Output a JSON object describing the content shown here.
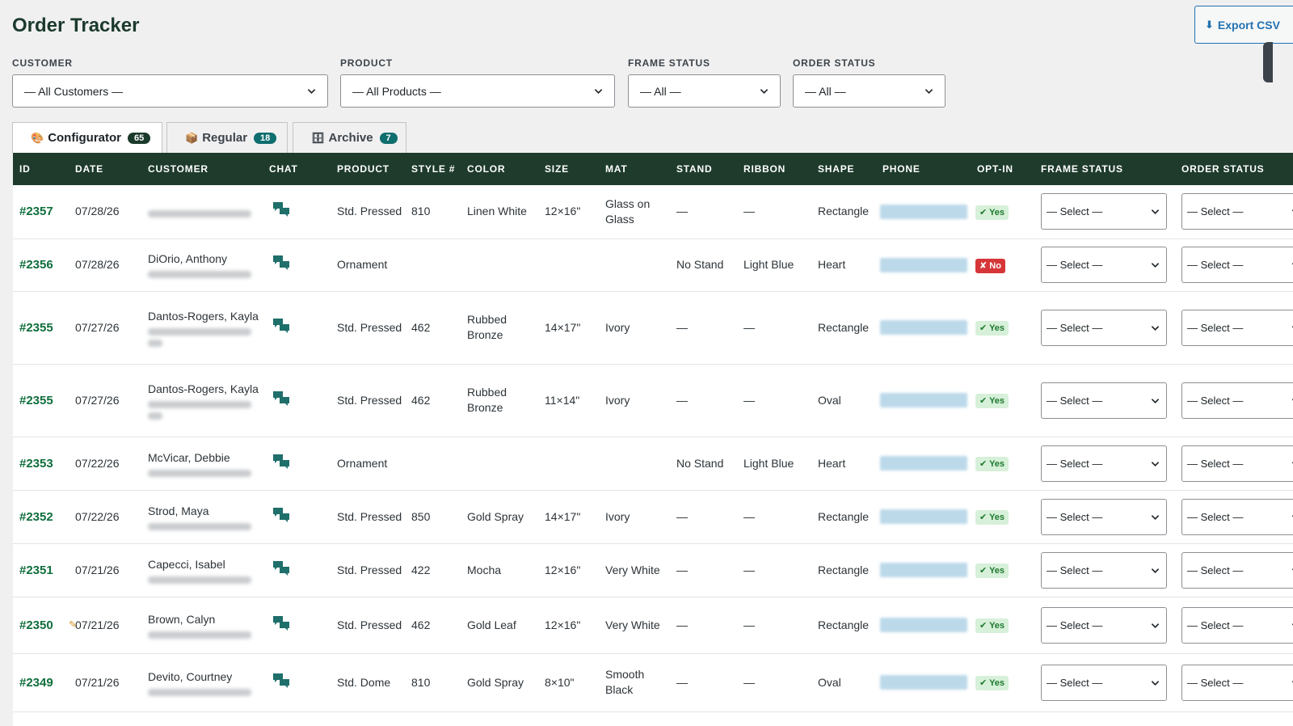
{
  "page": {
    "title": "Order Tracker"
  },
  "toolbar": {
    "export_label": "Export CSV"
  },
  "filters": [
    {
      "label": "CUSTOMER",
      "value": "— All Customers —"
    },
    {
      "label": "PRODUCT",
      "value": "— All Products —"
    },
    {
      "label": "FRAME STATUS",
      "value": "— All —"
    },
    {
      "label": "ORDER STATUS",
      "value": "— All —"
    }
  ],
  "tabs": [
    {
      "label": "Configurator",
      "count": "65",
      "icon": "palette-icon"
    },
    {
      "label": "Regular",
      "count": "18",
      "icon": "box-icon"
    },
    {
      "label": "Archive",
      "count": "7",
      "icon": "archive-icon"
    }
  ],
  "table": {
    "columns": [
      "ID",
      "DATE",
      "CUSTOMER",
      "CHAT",
      "PRODUCT",
      "STYLE #",
      "COLOR",
      "SIZE",
      "MAT",
      "STAND",
      "RIBBON",
      "SHAPE",
      "PHONE",
      "OPT-IN",
      "FRAME STATUS",
      "ORDER STATUS"
    ],
    "rows": [
      {
        "id": "#2357",
        "date": "07/28/26",
        "customer": "",
        "product": "Std. Pressed",
        "style": "810",
        "color": "Linen White",
        "size": "12×16\"",
        "mat": "Glass on Glass",
        "stand": "—",
        "ribbon": "—",
        "shape": "Rectangle",
        "optin": "✔ Yes",
        "optin_state": "yes",
        "frame_status": "— Select —",
        "order_status": "— Select —"
      },
      {
        "id": "#2356",
        "date": "07/28/26",
        "customer": "DiOrio, Anthony",
        "product": "Ornament",
        "style": "",
        "color": "",
        "size": "",
        "mat": "",
        "stand": "No Stand",
        "ribbon": "Light Blue",
        "shape": "Heart",
        "optin": "✘ No",
        "optin_state": "no",
        "frame_status": "— Select —",
        "order_status": "— Select —"
      },
      {
        "id": "#2355",
        "date": "07/27/26",
        "customer": "Dantos-Rogers, Kayla",
        "product": "Std. Pressed",
        "style": "462",
        "color": "Rubbed Bronze",
        "size": "14×17\"",
        "mat": "Ivory",
        "stand": "—",
        "ribbon": "—",
        "shape": "Rectangle",
        "optin": "✔ Yes",
        "optin_state": "yes",
        "frame_status": "— Select —",
        "order_status": "— Select —"
      },
      {
        "id": "#2355",
        "date": "07/27/26",
        "customer": "Dantos-Rogers, Kayla",
        "product": "Std. Pressed",
        "style": "462",
        "color": "Rubbed Bronze",
        "size": "11×14\"",
        "mat": "Ivory",
        "stand": "—",
        "ribbon": "—",
        "shape": "Oval",
        "optin": "✔ Yes",
        "optin_state": "yes",
        "frame_status": "— Select —",
        "order_status": "— Select —"
      },
      {
        "id": "#2353",
        "date": "07/22/26",
        "customer": "McVicar, Debbie",
        "product": "Ornament",
        "style": "",
        "color": "",
        "size": "",
        "mat": "",
        "stand": "No Stand",
        "ribbon": "Light Blue",
        "shape": "Heart",
        "optin": "✔ Yes",
        "optin_state": "yes",
        "frame_status": "— Select —",
        "order_status": "— Select —"
      },
      {
        "id": "#2352",
        "date": "07/22/26",
        "customer": "Strod, Maya",
        "product": "Std. Pressed",
        "style": "850",
        "color": "Gold Spray",
        "size": "14×17\"",
        "mat": "Ivory",
        "stand": "—",
        "ribbon": "—",
        "shape": "Rectangle",
        "optin": "✔ Yes",
        "optin_state": "yes",
        "frame_status": "— Select —",
        "order_status": "— Select —"
      },
      {
        "id": "#2351",
        "date": "07/21/26",
        "customer": "Capecci, Isabel",
        "product": "Std. Pressed",
        "style": "422",
        "color": "Mocha",
        "size": "12×16\"",
        "mat": "Very White",
        "stand": "—",
        "ribbon": "—",
        "shape": "Rectangle",
        "optin": "✔ Yes",
        "optin_state": "yes",
        "frame_status": "— Select —",
        "order_status": "— Select —"
      },
      {
        "id": "#2350",
        "date": "07/21/26",
        "customer": "Brown, Calyn",
        "product": "Std. Pressed",
        "style": "462",
        "color": "Gold Leaf",
        "size": "12×16\"",
        "mat": "Very White",
        "stand": "—",
        "ribbon": "—",
        "shape": "Rectangle",
        "optin": "✔ Yes",
        "optin_state": "yes",
        "frame_status": "— Select —",
        "order_status": "— Select —",
        "edited": true
      },
      {
        "id": "#2349",
        "date": "07/21/26",
        "customer": "Devito, Courtney",
        "product": "Std. Dome",
        "style": "810",
        "color": "Gold Spray",
        "size": "8×10\"",
        "mat": "Smooth Black",
        "stand": "—",
        "ribbon": "—",
        "shape": "Oval",
        "optin": "✔ Yes",
        "optin_state": "yes",
        "frame_status": "— Select —",
        "order_status": "— Select —"
      }
    ]
  },
  "colors": {
    "header_bg": "#1e3b2c",
    "id_link": "#0f6e3c",
    "accent": "#2271b1",
    "chat_icon": "#1f6f6b",
    "yes_bg": "#d7f0d9",
    "no_bg": "#d63638"
  }
}
